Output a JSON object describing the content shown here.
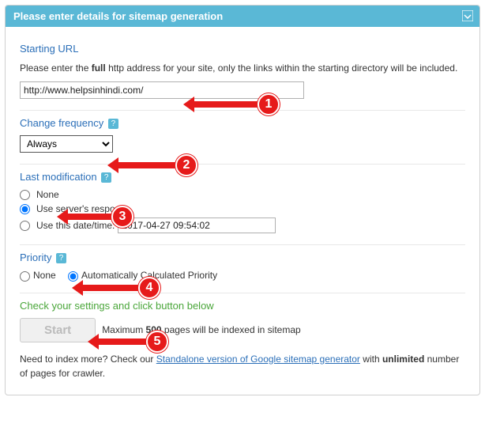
{
  "header": {
    "title": "Please enter details for sitemap generation"
  },
  "url_section": {
    "title": "Starting URL",
    "desc_prefix": "Please enter the ",
    "desc_bold": "full",
    "desc_suffix": " http address for your site, only the links within the starting directory will be included.",
    "value": "http://www.helpsinhindi.com/"
  },
  "freq_section": {
    "title": "Change frequency",
    "value": "Always"
  },
  "lastmod_section": {
    "title": "Last modification",
    "opt_none": "None",
    "opt_server": "Use server's response",
    "opt_date": "Use this date/time:",
    "date_value": "2017-04-27 09:54:02"
  },
  "priority_section": {
    "title": "Priority",
    "opt_none": "None",
    "opt_auto": "Automatically Calculated Priority"
  },
  "start_section": {
    "title": "Check your settings and click button below",
    "button": "Start",
    "note_pre": "Maximum ",
    "note_bold": "500",
    "note_post": " pages will be indexed in sitemap"
  },
  "footer": {
    "pre": "Need to index more? Check our ",
    "link": "Standalone version of Google sitemap generator",
    "mid": " with ",
    "bold": "unlimited",
    "post": " number of pages for crawler."
  },
  "annotations": {
    "a1": "1",
    "a2": "2",
    "a3": "3",
    "a4": "4",
    "a5": "5"
  }
}
